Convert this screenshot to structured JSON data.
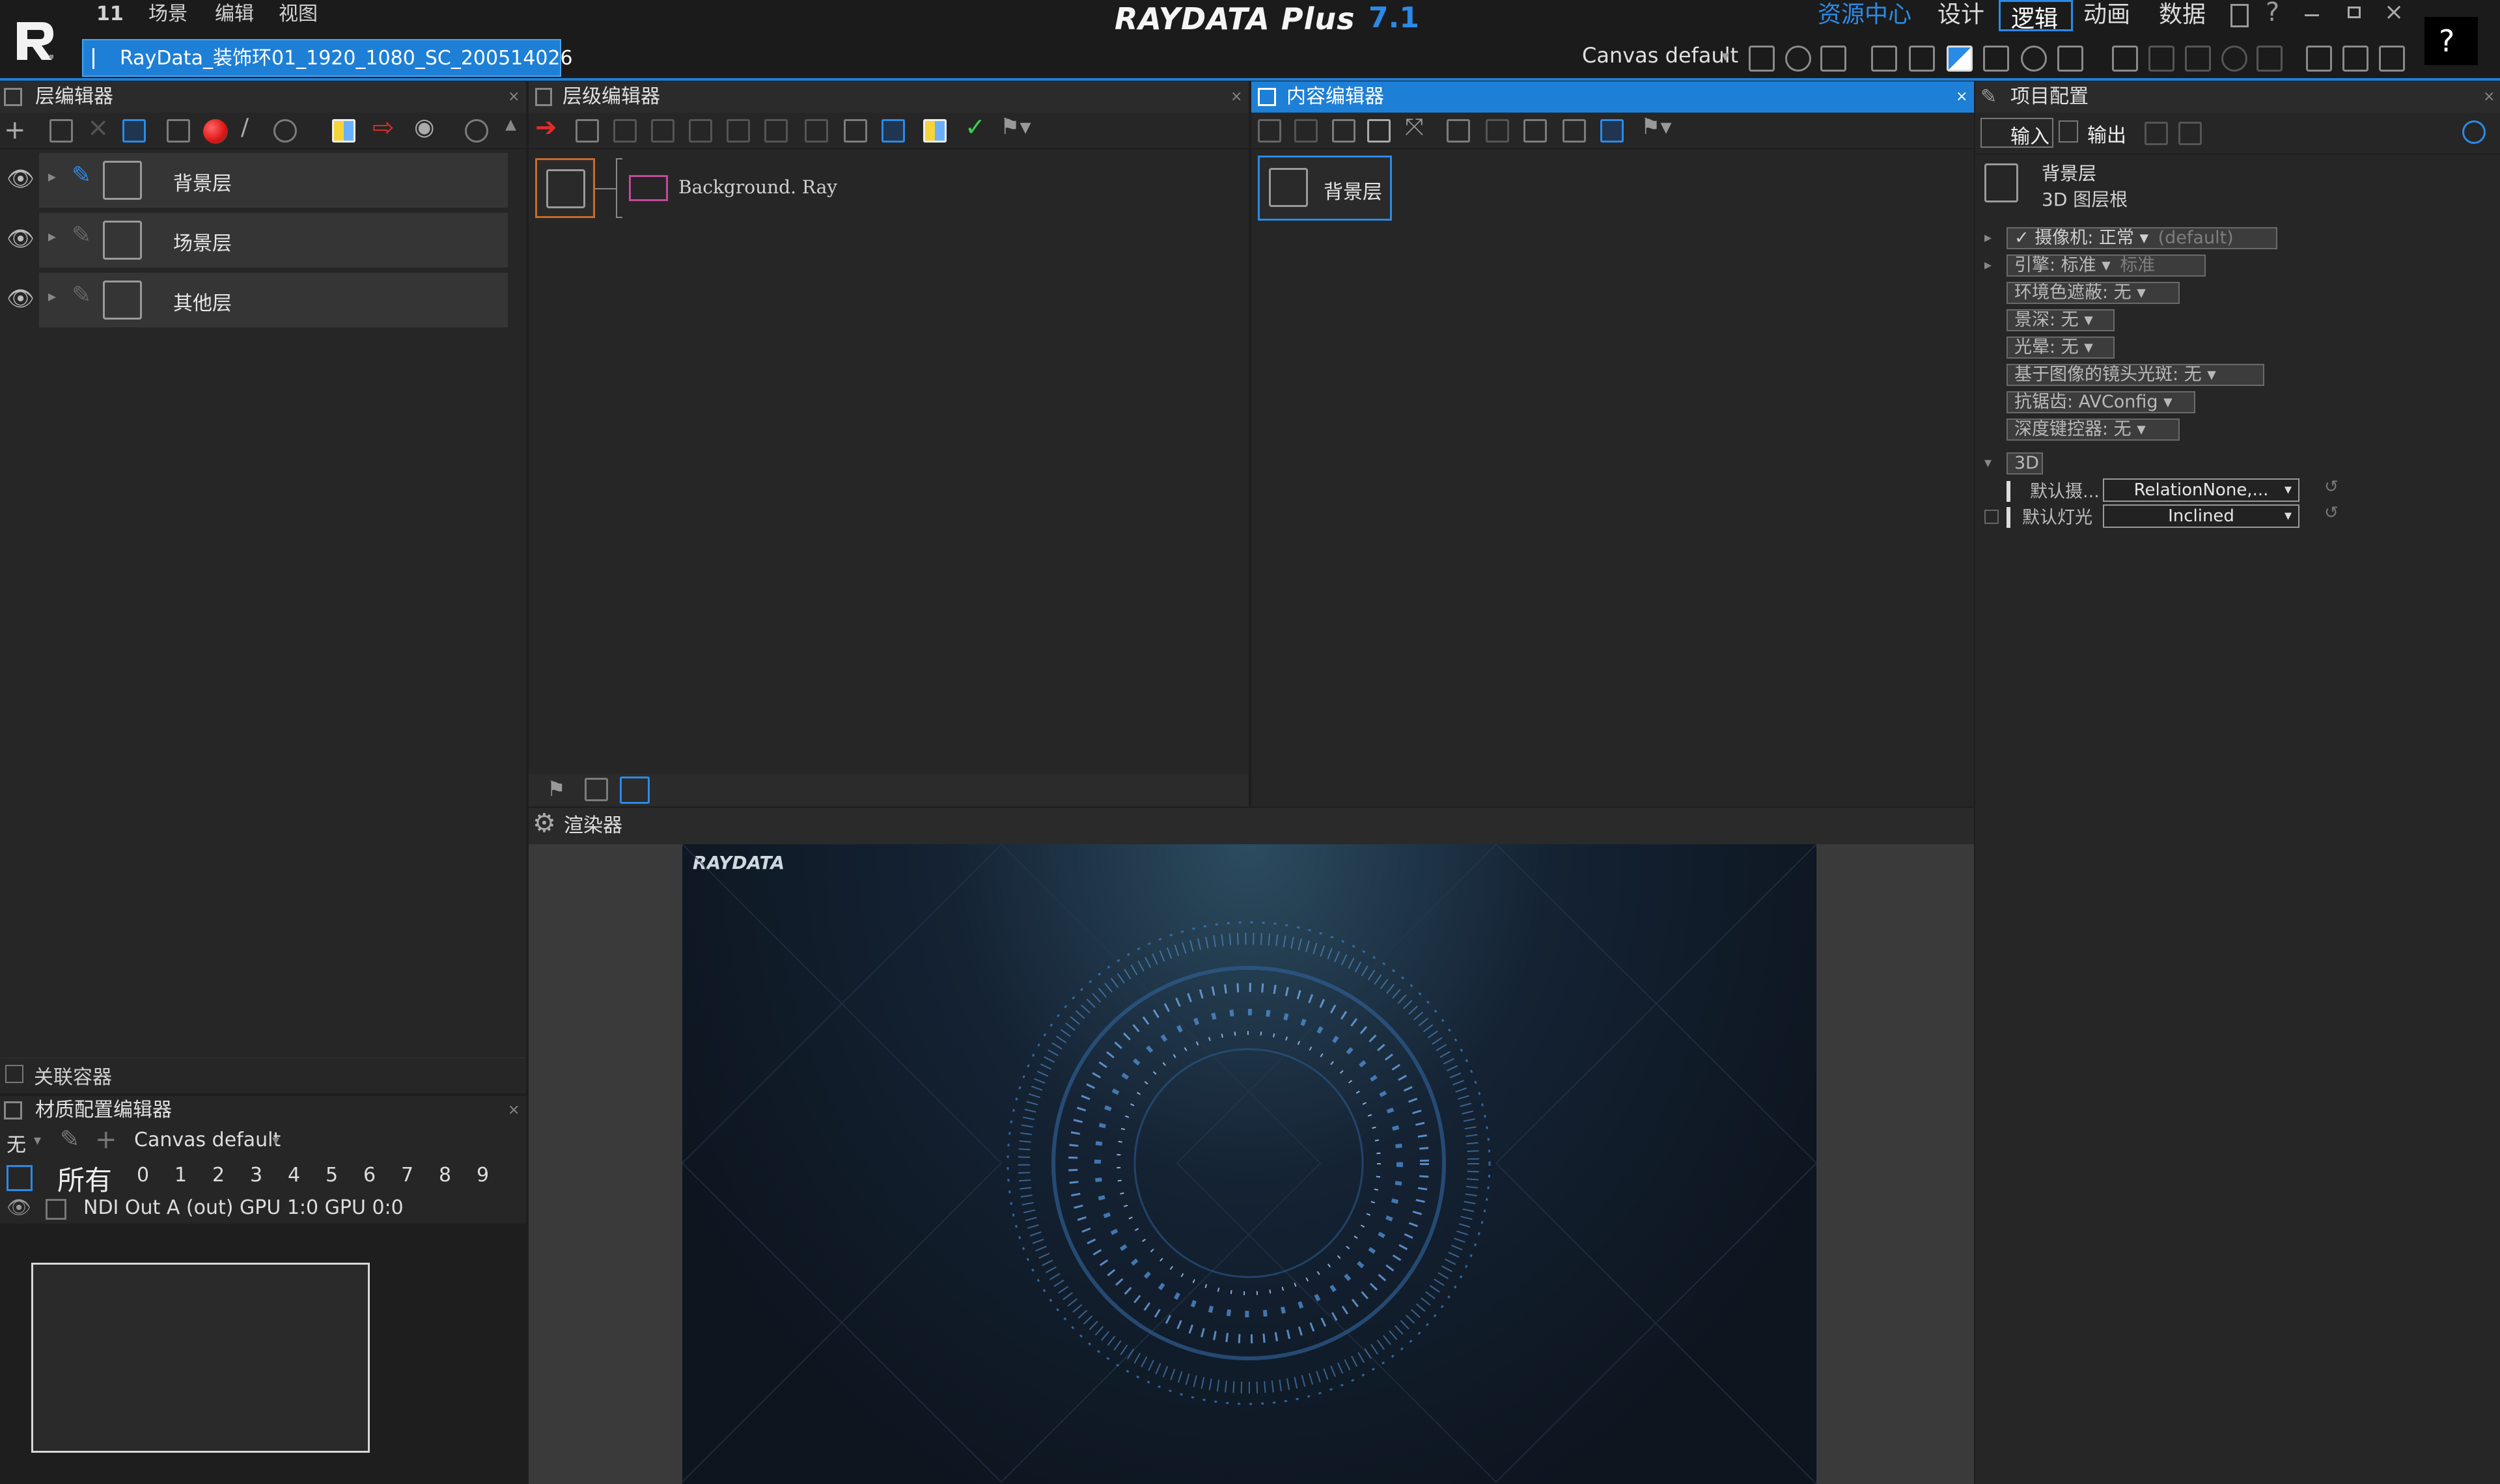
{
  "menu": {
    "version_short": "11",
    "items": [
      "场景",
      "编辑",
      "视图"
    ]
  },
  "app": {
    "brand": "RAYDATA Plus",
    "version": "7.1"
  },
  "modes": {
    "resource_center": "资源中心",
    "tabs": [
      "设计",
      "逻辑",
      "动画",
      "数据"
    ],
    "active_tab": "逻辑"
  },
  "project_tab": {
    "label": "RayData_装饰环01_1920_1080_SC_200514026"
  },
  "toolbar": {
    "canvas_select": "Canvas default"
  },
  "layer_editor": {
    "title": "层编辑器",
    "layers": [
      {
        "name": "背景层"
      },
      {
        "name": "场景层"
      },
      {
        "name": "其他层"
      }
    ],
    "linked_container": "关联容器"
  },
  "material_editor": {
    "title": "材质配置编辑器",
    "none_label": "无",
    "canvas_select": "Canvas default",
    "all_label": "所有",
    "channels": [
      "0",
      "1",
      "2",
      "3",
      "4",
      "5",
      "6",
      "7",
      "8",
      "9"
    ],
    "output_row": "NDI Out A (out)   GPU 1:0   GPU 0:0"
  },
  "hierarchy_editor": {
    "title": "层级编辑器",
    "node_label": "Background. Ray"
  },
  "content_editor": {
    "title": "内容编辑器",
    "node_label": "背景层"
  },
  "renderer": {
    "title": "渲染器",
    "watermark": "RAYDATA"
  },
  "project_config": {
    "title": "项目配置",
    "tab_input": "输入",
    "tab_output": "输出",
    "root_name": "背景层",
    "root_type": "3D 图层根",
    "props": [
      {
        "label": "✓  摄像机: 正常 ▾",
        "extra": "(default)"
      },
      {
        "label": "引擎: 标准 ▾",
        "extra": "标准"
      },
      {
        "label": "环境色遮蔽: 无 ▾",
        "extra": ""
      },
      {
        "label": "景深: 无 ▾",
        "extra": ""
      },
      {
        "label": "光晕: 无 ▾",
        "extra": ""
      },
      {
        "label": "基于图像的镜头光斑: 无 ▾",
        "extra": ""
      },
      {
        "label": "抗锯齿: AVConfig ▾",
        "extra": ""
      },
      {
        "label": "深度键控器: 无 ▾",
        "extra": ""
      }
    ],
    "section_3d": "3D",
    "default_camera_label": "默认摄...",
    "default_camera_value": "RelationNone,...",
    "default_light_label": "默认灯光",
    "default_light_value": "Inclined"
  },
  "colors": {
    "accent": "#1e7fd6",
    "active_tab_border": "#2b8ae6",
    "brand_version": "#2b8ae6",
    "resource_center": "#2b8ae6"
  }
}
